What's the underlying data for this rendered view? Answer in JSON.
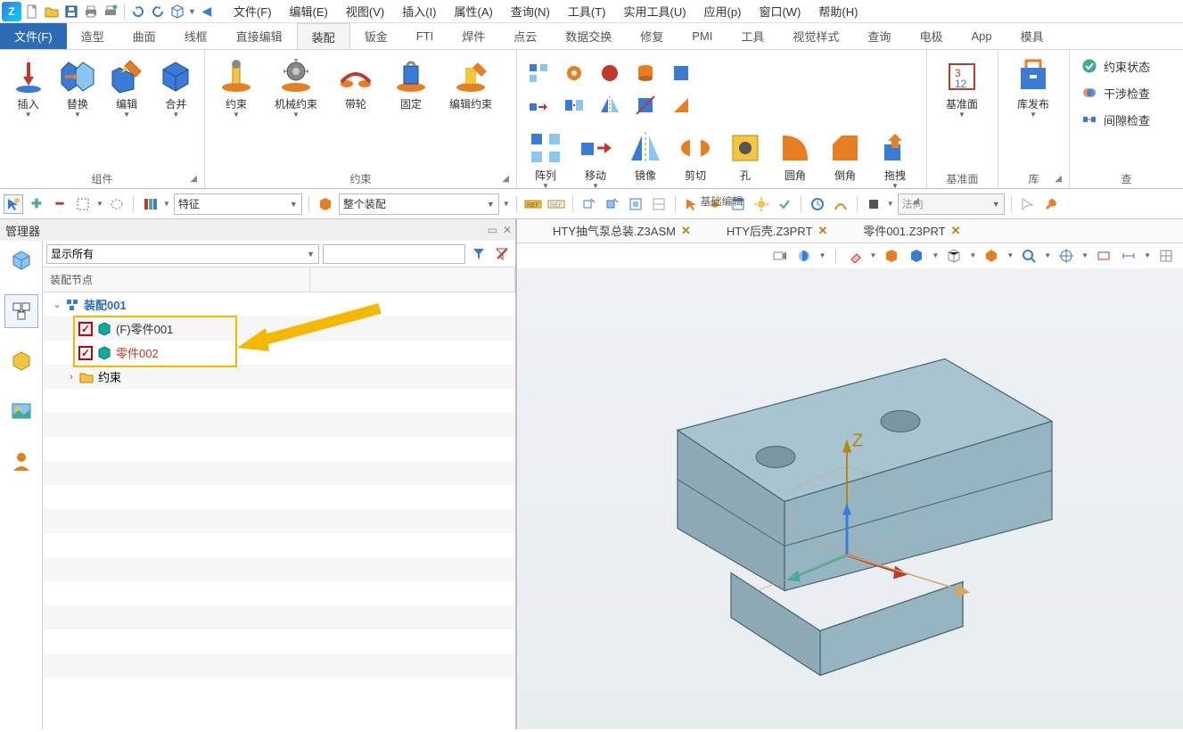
{
  "menu": {
    "items": [
      "文件(F)",
      "编辑(E)",
      "视图(V)",
      "插入(I)",
      "属性(A)",
      "查询(N)",
      "工具(T)",
      "实用工具(U)",
      "应用(p)",
      "窗口(W)",
      "帮助(H)"
    ]
  },
  "ribbon_tabs": [
    "文件(F)",
    "造型",
    "曲面",
    "线框",
    "直接编辑",
    "装配",
    "钣金",
    "FTI",
    "焊件",
    "点云",
    "数据交换",
    "修复",
    "PMI",
    "工具",
    "视觉样式",
    "查询",
    "电极",
    "App",
    "模具"
  ],
  "ribbon_active_blue": 0,
  "ribbon_active_light": 5,
  "ribbon": {
    "group1": {
      "label": "组件",
      "btns": [
        "插入",
        "替换",
        "编辑",
        "合并"
      ]
    },
    "group2": {
      "label": "约束",
      "btns": [
        "约束",
        "机械约束",
        "带轮",
        "固定",
        "编辑约束"
      ]
    },
    "group3": {
      "label": "基础编辑",
      "btns": [
        "阵列",
        "移动",
        "镜像",
        "剪切",
        "孔",
        "圆角",
        "倒角",
        "拖拽"
      ]
    },
    "group4": {
      "label": "基准面",
      "btns": [
        "基准面"
      ]
    },
    "group5": {
      "label": "库",
      "btns": [
        "库发布"
      ]
    },
    "group6": {
      "label": "查",
      "btns": [
        "约束状态",
        "干涉检查",
        "间隙检查"
      ]
    }
  },
  "sec_toolbar": {
    "dd1": "特征",
    "dd2": "整个装配",
    "dd3": "法向"
  },
  "manager": {
    "title": "管理器",
    "filter": "显示所有",
    "header_col": "装配节点",
    "tree": {
      "root": "装配001",
      "item1": "(F)零件001",
      "item2": "零件002",
      "item3": "约束"
    }
  },
  "doc_tabs": [
    {
      "label": "HTY抽气泵总装.Z3ASM"
    },
    {
      "label": "HTY后壳.Z3PRT"
    },
    {
      "label": "零件001.Z3PRT"
    }
  ],
  "axis_label": "Z"
}
